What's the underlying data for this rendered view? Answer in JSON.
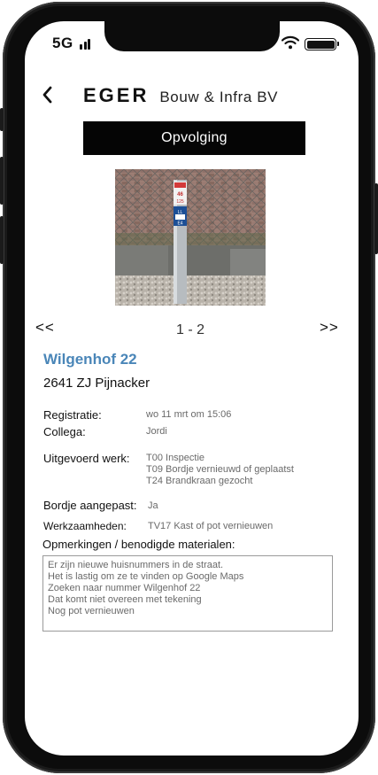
{
  "status_bar": {
    "network": "5G"
  },
  "header": {
    "brand_name": "EGER",
    "brand_sub": "Bouw & Infra BV",
    "title": "Opvolging"
  },
  "pager": {
    "prev": "<<",
    "indicator": "1 - 2",
    "next": ">>"
  },
  "address": {
    "street": "Wilgenhof 22",
    "postal": "2641 ZJ Pijnacker"
  },
  "details": {
    "registratie_label": "Registratie:",
    "registratie_value": "wo 11 mrt om 15:06",
    "collega_label": "Collega:",
    "collega_value": "Jordi",
    "werk_label": "Uitgevoerd werk:",
    "werk_items": [
      "T00 Inspectie",
      "T09 Bordje vernieuwd of geplaatst",
      "T24 Brandkraan gezocht"
    ],
    "bordje_label": "Bordje aangepast:",
    "bordje_value": "Ja",
    "werkzaamheden_label": "Werkzaamheden:",
    "werkzaamheden_value": "TV17 Kast of pot vernieuwen"
  },
  "remarks": {
    "label": "Opmerkingen / benodigde materialen:",
    "text": "Er zijn nieuwe huisnummers in de straat.\nHet is lastig om ze te vinden op Google Maps\nZoeken naar nummer Wilgenhof 22\nDat komt niet overeen met tekening\nNog pot vernieuwen"
  },
  "photo": {
    "sign_top": "46",
    "sign_mid": "125",
    "sign_low": "LL",
    "sign_bot": "E4"
  },
  "colors": {
    "accent": "#4a86b8",
    "banner": "#050505"
  }
}
